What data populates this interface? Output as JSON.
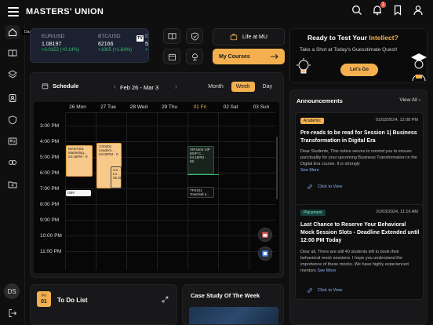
{
  "app": {
    "brand": "MASTERS' UNION"
  },
  "sidebar": {
    "tooltip": "Dashboard",
    "avatar": "DS"
  },
  "topbar": {
    "notification_count": "1"
  },
  "tickers": [
    {
      "name": "EUR/USD",
      "value": "1.08197",
      "change": "+0.0152 (+0.14%)"
    },
    {
      "name": "BTC/USD",
      "value": "62166",
      "change": "+1005 (+1.64%)"
    },
    {
      "name": "E",
      "value": "5",
      "change": "+"
    }
  ],
  "tv_logo": "TV",
  "quick_links": {
    "life": "Life at MU",
    "courses": "My Courses"
  },
  "promo": {
    "title_pre": "Ready to Test Your ",
    "title_hl": "Intellect?",
    "subtitle": "Take a Shot at Today's Guesstimate Quest!",
    "button": "Let's Go"
  },
  "schedule": {
    "title": "Schedule",
    "range": "Feb 26 - Mar 3",
    "prev": "‹",
    "next": "›",
    "views": [
      "Month",
      "Week",
      "Day"
    ],
    "days": [
      "26 Mon",
      "27 Tue",
      "28 Wed",
      "29 Thu",
      "01 Fri",
      "02 Sat",
      "03 Sun"
    ],
    "times": [
      "3:00 PM",
      "4:00 PM",
      "5:00 PM",
      "6:00 PM",
      "7:00 PM",
      "8:00 PM",
      "9:00 PM",
      "10:00 PM",
      "11:00 PM"
    ],
    "events": [
      {
        "title": "MAST401 Marketing...",
        "time": "04:15PM - 0"
      },
      {
        "title": "CX0401 Leaders...",
        "time": "04:00PM - 0"
      },
      {
        "title": "CX.. Le...",
        "time": "05:30"
      },
      {
        "title": "OBF",
        "time": ""
      },
      {
        "title": "VIP4404 VIP MVP C...",
        "time": "04:15PM - 06:"
      },
      {
        "title": "TP4101 Townhall a...",
        "time": ""
      }
    ]
  },
  "todo": {
    "badge_day": "Fri",
    "badge_date": "01",
    "title": "To Do List"
  },
  "case_study": {
    "title": "Case Study Of The Week"
  },
  "announcements": {
    "title": "Announcements",
    "view_all": "View All",
    "link_label": "Click to View",
    "items": [
      {
        "tag": "Academic",
        "date": "01/03/2024, 12:08 PM",
        "title": "Pre-reads to be read for Session 1| Business Transformation in Digital Era",
        "body": "Dear Students, This notice serves to remind you to ensure punctuality for your upcoming Business Transformation in the Digital Era course. It is strongly",
        "see_more": "See More"
      },
      {
        "tag": "Placement",
        "date": "01/03/2024, 11:16 AM",
        "title": "Last Chance to Reserve Your Behavioral Mock Session Slots - Deadline Extended until 12:00 PM Today",
        "body": "Dear all, There are still 40 students left to book their behavioral mock sessions. I hope you understand the importance of these mocks. We have highly experienced mentors",
        "see_more": "See More"
      }
    ]
  }
}
